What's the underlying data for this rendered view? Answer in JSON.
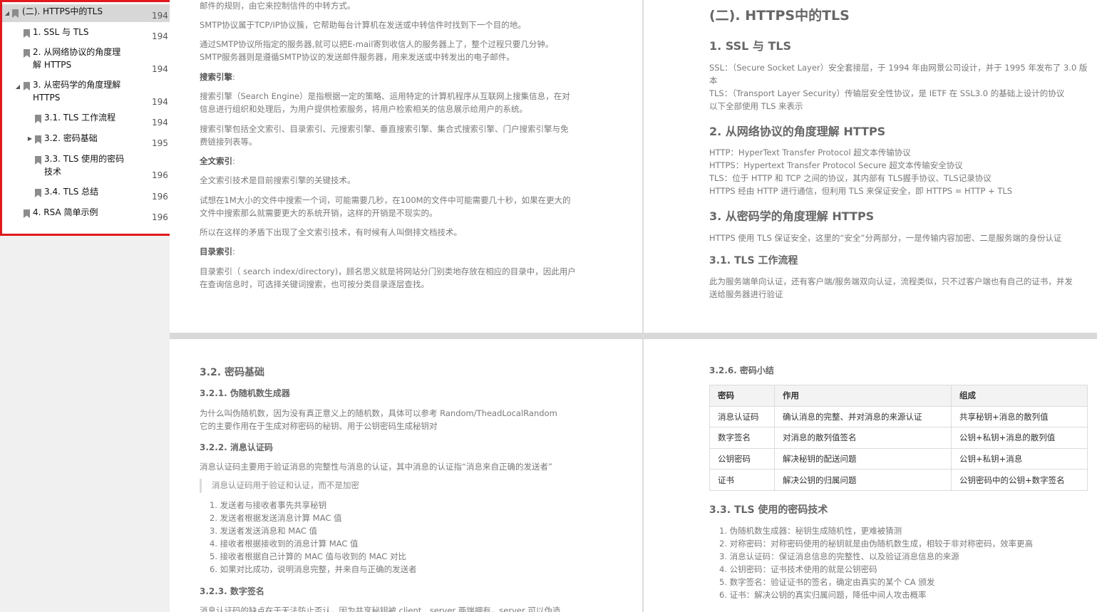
{
  "outline": {
    "items": [
      {
        "label": "(二). HTTPS中的TLS",
        "page": "194",
        "arrow": "◢",
        "selected": true
      },
      {
        "label": "1. SSL 与 TLS",
        "page": "194",
        "arrow": ""
      },
      {
        "label": "2. 从网络协议的角度理解 HTTPS",
        "page": "194",
        "arrow": ""
      },
      {
        "label": "3. 从密码学的角度理解 HTTPS",
        "page": "194",
        "arrow": "◢"
      },
      {
        "label": "3.1. TLS 工作流程",
        "page": "194",
        "arrow": ""
      },
      {
        "label": "3.2. 密码基础",
        "page": "195",
        "arrow": "▶"
      },
      {
        "label": "3.3. TLS 使用的密码技术",
        "page": "196",
        "arrow": ""
      },
      {
        "label": "3.4. TLS 总结",
        "page": "196",
        "arrow": ""
      },
      {
        "label": "4. RSA 简单示例",
        "page": "196",
        "arrow": ""
      }
    ]
  },
  "page_tl": {
    "p0": "邮件的规则，由它来控制信件的中转方式。",
    "p1": "SMTP协议属于TCP/IP协议簇，它帮助每台计算机在发送或中转信件时找到下一个目的地。",
    "p2a": "通过SMTP协议所指定的服务器,就可以把E-mail寄到收信人的服务器上了，整个过程只要几分钟。",
    "p2b": "SMTP服务器则是遵循SMTP协议的发送邮件服务器，用来发送或中转发出的电子邮件。",
    "h_search": "搜索引擎",
    "colon": ":",
    "p3a": "搜索引擎（Search Engine）是指根据一定的策略、运用特定的计算机程序从互联网上搜集信息，在对",
    "p3b": "信息进行组织和处理后，为用户提供检索服务，将用户检索相关的信息展示给用户的系统。",
    "p4a": "搜索引擎包括全文索引、目录索引、元搜索引擎、垂直搜索引擎、集合式搜索引擎、门户搜索引擎与免",
    "p4b": "费链接列表等。",
    "h_fulltext": "全文索引",
    "p5": "全文索引技术是目前搜索引擎的关键技术。",
    "p6a": "试想在1M大小的文件中搜索一个词，可能需要几秒，在100M的文件中可能需要几十秒，如果在更大的",
    "p6b": "文件中搜索那么就需要更大的系统开销，这样的开销是不现实的。",
    "p7": "所以在这样的矛盾下出现了全文索引技术，有时候有人叫倒排文档技术。",
    "h_dir": "目录索引",
    "p8a": "目录索引（ search index/directory)，顾名思义就是将网站分门别类地存放在相应的目录中，因此用户",
    "p8b": "在查询信息时，可选择关键词搜索，也可按分类目录逐层查找。"
  },
  "page_tr": {
    "h2": "(二). HTTPS中的TLS",
    "h_ssl": "1. SSL 与 TLS",
    "ssl1": "SSL：（Secure Socket Layer）安全套接层，于 1994 年由网景公司设计，并于 1995 年发布了 3.0 版",
    "ssl1b": "本",
    "ssl2": "TLS：（Transport Layer Security）传输层安全性协议，是 IETF 在 SSL3.0 的基础上设计的协议",
    "ssl3": "以下全部使用 TLS 来表示",
    "h_net": "2. 从网络协议的角度理解 HTTPS",
    "net1": "HTTP：HyperText Transfer Protocol 超文本传输协议",
    "net2": "HTTPS：Hypertext Transfer Protocol Secure 超文本传输安全协议",
    "net3": "TLS：位于 HTTP 和 TCP 之间的协议，其内部有 TLS握手协议、TLS记录协议",
    "net4": "HTTPS 经由 HTTP 进行通信，但利用 TLS 来保证安全，即 HTTPS = HTTP + TLS",
    "h_crypto": "3. 从密码学的角度理解 HTTPS",
    "crypto1": "HTTPS 使用 TLS 保证安全，这里的“安全”分两部分，一是传输内容加密、二是服务端的身份认证",
    "h_flow": "3.1. TLS 工作流程",
    "flow1": "此为服务端单向认证，还有客户端/服务端双向认证，流程类似，只不过客户端也有自己的证书，并发",
    "flow2": "送给服务器进行验证"
  },
  "page_bl": {
    "h_basic": "3.2. 密码基础",
    "h_prng": "3.2.1. 伪随机数生成器",
    "prng1": "为什么叫伪随机数，因为没有真正意义上的随机数，具体可以参考 Random/TheadLocalRandom",
    "prng2": "它的主要作用在于生成对称密码的秘钥、用于公钥密码生成秘钥对",
    "h_mac": "3.2.2. 消息认证码",
    "mac1": "消息认证码主要用于验证消息的完整性与消息的认证，其中消息的认证指“消息来自正确的发送者”",
    "quote": "消息认证码用于验证和认证，而不是加密",
    "steps": [
      "1. 发送者与接收者事先共享秘钥",
      "2. 发送者根据发送消息计算 MAC 值",
      "3. 发送者发送消息和 MAC 值",
      "4. 接收者根据接收到的消息计算 MAC 值",
      "5. 接收者根据自己计算的 MAC 值与收到的 MAC 对比",
      "6. 如果对比成功，说明消息完整，并来自与正确的发送者"
    ],
    "h_sig": "3.2.3. 数字签名",
    "sig1": "消息认证码的缺点在于无法防止否认，因为共享秘钥被 client、server 两端拥有，server 可以伪造"
  },
  "page_br": {
    "h_summary": "3.2.6. 密码小结",
    "table": {
      "headers": [
        "密码",
        "作用",
        "组成"
      ],
      "rows": [
        [
          "消息认证码",
          "确认消息的完整、并对消息的来源认证",
          "共享秘钥+消息的散列值"
        ],
        [
          "数字签名",
          "对消息的散列值签名",
          "公钥+私钥+消息的散列值"
        ],
        [
          "公钥密码",
          "解决秘钥的配送问题",
          "公钥+私钥+消息"
        ],
        [
          "证书",
          "解决公钥的归属问题",
          "公钥密码中的公钥+数字签名"
        ]
      ]
    },
    "h_tech": "3.3. TLS 使用的密码技术",
    "tech": [
      "1. 伪随机数生成器：秘钥生成随机性，更难被猜测",
      "2. 对称密码：对称密码使用的秘钥就是由伪随机数生成，相较于非对称密码，效率更高",
      "3. 消息认证码：保证消息信息的完整性、以及验证消息信息的来源",
      "4. 公钥密码：证书技术使用的就是公钥密码",
      "5. 数字签名：验证证书的签名，确定由真实的某个 CA 颁发",
      "6. 证书：解决公钥的真实归属问题，降低中间人攻击概率"
    ]
  }
}
